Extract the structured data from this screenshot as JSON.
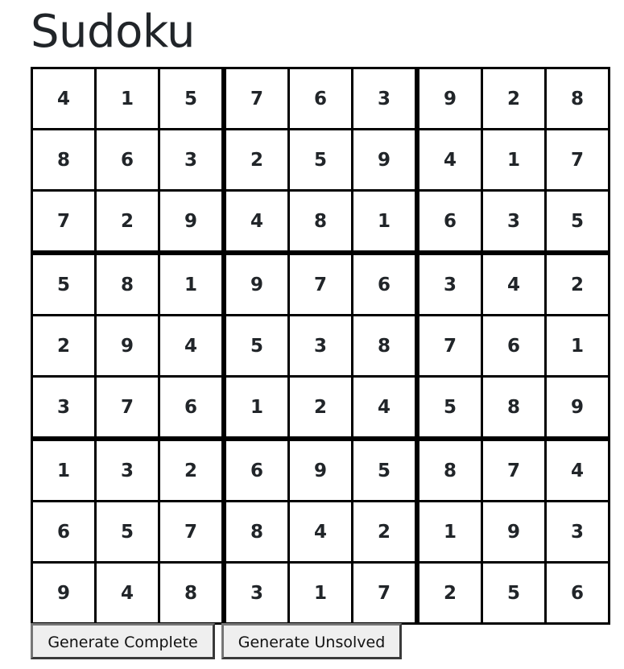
{
  "page": {
    "title": "Sudoku"
  },
  "board": {
    "rows": [
      [
        "4",
        "1",
        "5",
        "7",
        "6",
        "3",
        "9",
        "2",
        "8"
      ],
      [
        "8",
        "6",
        "3",
        "2",
        "5",
        "9",
        "4",
        "1",
        "7"
      ],
      [
        "7",
        "2",
        "9",
        "4",
        "8",
        "1",
        "6",
        "3",
        "5"
      ],
      [
        "5",
        "8",
        "1",
        "9",
        "7",
        "6",
        "3",
        "4",
        "2"
      ],
      [
        "2",
        "9",
        "4",
        "5",
        "3",
        "8",
        "7",
        "6",
        "1"
      ],
      [
        "3",
        "7",
        "6",
        "1",
        "2",
        "4",
        "5",
        "8",
        "9"
      ],
      [
        "1",
        "3",
        "2",
        "6",
        "9",
        "5",
        "8",
        "7",
        "4"
      ],
      [
        "6",
        "5",
        "7",
        "8",
        "4",
        "2",
        "1",
        "9",
        "3"
      ],
      [
        "9",
        "4",
        "8",
        "3",
        "1",
        "7",
        "2",
        "5",
        "6"
      ]
    ]
  },
  "buttons": {
    "generate_complete": "Generate Complete",
    "generate_unsolved": "Generate Unsolved"
  }
}
